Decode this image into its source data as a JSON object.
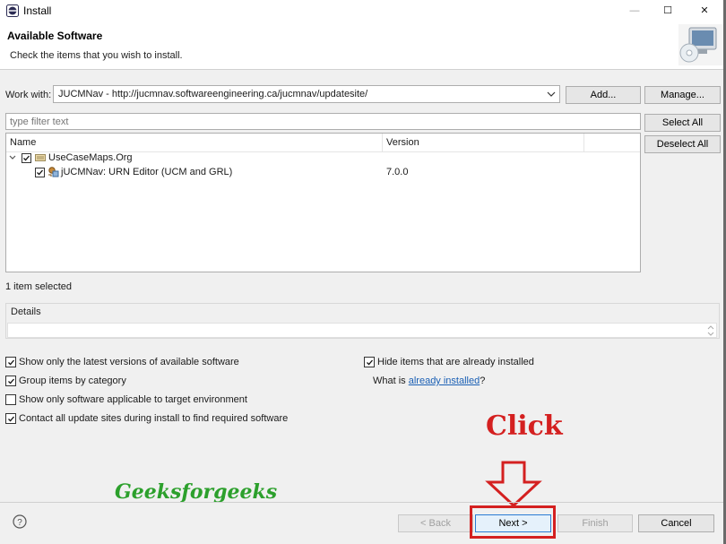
{
  "window": {
    "title": "Install",
    "minimize_glyph": "—",
    "maximize_glyph": "☐",
    "close_glyph": "✕"
  },
  "header": {
    "title": "Available Software",
    "description": "Check the items that you wish to install."
  },
  "work_with": {
    "label": "Work with:",
    "value": "JUCMNav - http://jucmnav.softwareengineering.ca/jucmnav/updatesite/",
    "add_label": "Add...",
    "manage_label": "Manage..."
  },
  "filter": {
    "placeholder": "type filter text"
  },
  "side_buttons": {
    "select_all": "Select All",
    "deselect_all": "Deselect All"
  },
  "tree": {
    "columns": [
      "Name",
      "Version"
    ],
    "rows": [
      {
        "label": "UseCaseMaps.Org",
        "version": "",
        "checked": true,
        "expanded": true
      },
      {
        "label": "jUCMNav: URN Editor (UCM and GRL)",
        "version": "7.0.0",
        "checked": true
      }
    ]
  },
  "status": "1 item selected",
  "details": {
    "label": "Details"
  },
  "options": {
    "latest": {
      "label": "Show only the latest versions of available software",
      "checked": true
    },
    "group": {
      "label": "Group items by category",
      "checked": true
    },
    "applicable": {
      "label": "Show only software applicable to target environment",
      "checked": false
    },
    "contact": {
      "label": "Contact all update sites during install to find required software",
      "checked": true
    },
    "hide": {
      "label": "Hide items that are already installed",
      "checked": true
    },
    "already_prefix": "What is ",
    "already_link": "already installed",
    "already_suffix": "?"
  },
  "annotations": {
    "click_text": "Click",
    "watermark": "Geeksforgeeks",
    "highlight_color": "#d42020"
  },
  "footer": {
    "help_glyph": "?",
    "back_label": "< Back",
    "next_label": "Next >",
    "finish_label": "Finish",
    "cancel_label": "Cancel"
  },
  "colors": {
    "link": "#1a5fb4",
    "accent": "#2a7bd4",
    "watermark": "#2ca02c"
  }
}
